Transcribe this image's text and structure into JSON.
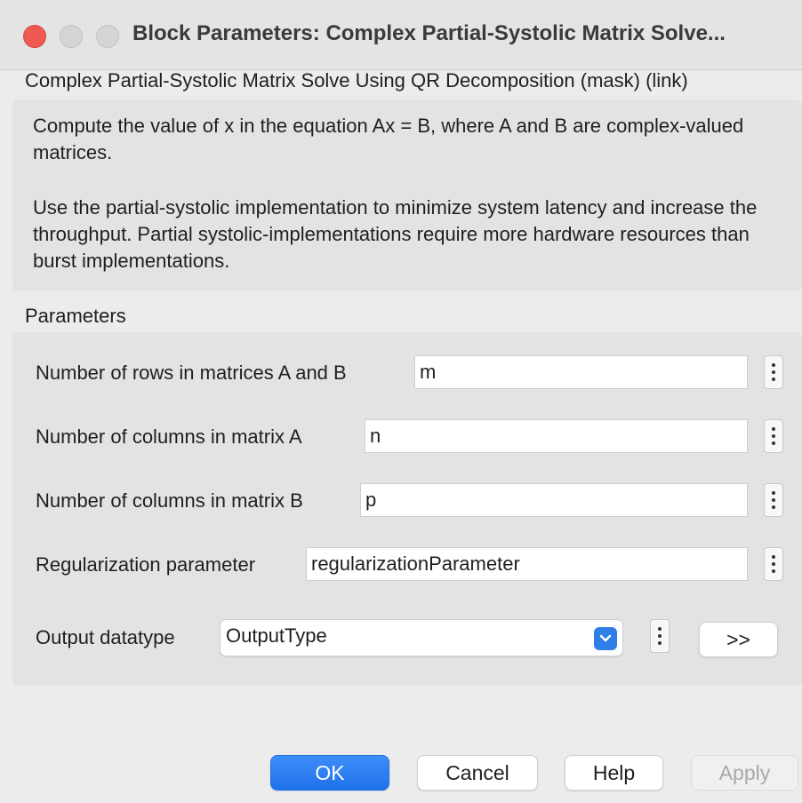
{
  "window": {
    "title": "Block Parameters: Complex Partial-Systolic Matrix Solve..."
  },
  "header": {
    "subtitle": "Complex Partial-Systolic Matrix Solve Using QR Decomposition (mask) (link)"
  },
  "description": {
    "paragraph1": "Compute the value of x in the equation Ax = B, where A and B are complex-valued matrices.",
    "paragraph2": "Use the partial-systolic implementation to minimize system latency and increase the throughput. Partial systolic-implementations require more hardware resources than burst implementations."
  },
  "parameters": {
    "section_label": "Parameters",
    "rows_label": "Number of rows in matrices A and B",
    "rows_value": "m",
    "colsA_label": "Number of columns in matrix A",
    "colsA_value": "n",
    "colsB_label": "Number of columns in matrix B",
    "colsB_value": "p",
    "reg_label": "Regularization parameter",
    "reg_value": "regularizationParameter",
    "dtype_label": "Output datatype",
    "dtype_value": "OutputType",
    "expand_label": ">>"
  },
  "buttons": {
    "ok": "OK",
    "cancel": "Cancel",
    "help": "Help",
    "apply": "Apply"
  },
  "colors": {
    "accent": "#2f7fe8",
    "close_light": "#ee5a52"
  },
  "icons": [
    "close-window-icon",
    "minimize-window-icon",
    "maximize-window-icon",
    "kebab-menu-icon",
    "chevron-down-icon"
  ]
}
